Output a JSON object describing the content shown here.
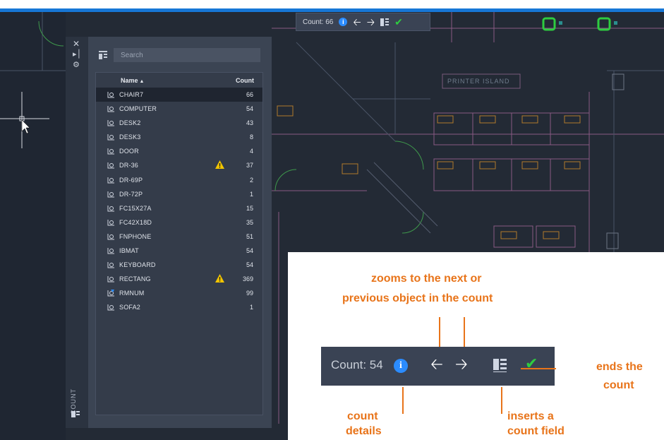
{
  "count_toolbar": {
    "label": "Count: 66",
    "info_glyph": "i"
  },
  "drawing": {
    "room_label": "PRINTER ISLAND"
  },
  "palette": {
    "vertical_label": "COUNT",
    "search_placeholder": "Search",
    "header_name": "Name",
    "header_count": "Count",
    "rows": [
      {
        "name": "CHAIR7",
        "count": "66",
        "selected": true,
        "warning": false
      },
      {
        "name": "COMPUTER",
        "count": "54",
        "selected": false,
        "warning": false
      },
      {
        "name": "DESK2",
        "count": "43",
        "selected": false,
        "warning": false
      },
      {
        "name": "DESK3",
        "count": "8",
        "selected": false,
        "warning": false
      },
      {
        "name": "DOOR",
        "count": "4",
        "selected": false,
        "warning": false
      },
      {
        "name": "DR-36",
        "count": "37",
        "selected": false,
        "warning": true
      },
      {
        "name": "DR-69P",
        "count": "2",
        "selected": false,
        "warning": false
      },
      {
        "name": "DR-72P",
        "count": "1",
        "selected": false,
        "warning": false
      },
      {
        "name": "FC15X27A",
        "count": "15",
        "selected": false,
        "warning": false
      },
      {
        "name": "FC42X18D",
        "count": "35",
        "selected": false,
        "warning": false
      },
      {
        "name": "FNPHONE",
        "count": "51",
        "selected": false,
        "warning": false
      },
      {
        "name": "IBMAT",
        "count": "54",
        "selected": false,
        "warning": false
      },
      {
        "name": "KEYBOARD",
        "count": "54",
        "selected": false,
        "warning": false
      },
      {
        "name": "RECTANG",
        "count": "369",
        "selected": false,
        "warning": true
      },
      {
        "name": "RMNUM",
        "count": "99",
        "selected": false,
        "warning": false
      },
      {
        "name": "SOFA2",
        "count": "1",
        "selected": false,
        "warning": false
      }
    ]
  },
  "callout": {
    "toolbar_label": "Count: 54",
    "zoom_line1": "zooms to the next or",
    "zoom_line2": "previous object in the count",
    "ends_line1": "ends the",
    "ends_line2": "count",
    "details_line1": "count",
    "details_line2": "details",
    "inserts_line1": "inserts a",
    "inserts_line2": "count field"
  },
  "colors": {
    "accent_blue": "#1777d6",
    "annotation_orange": "#e8741a",
    "check_green": "#2ecc40",
    "warning_yellow": "#f2c500"
  }
}
